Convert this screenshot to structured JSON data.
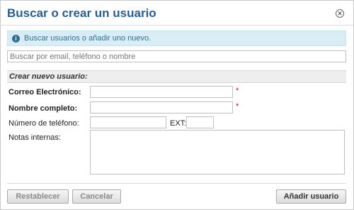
{
  "dialog": {
    "title": "Buscar o crear un usuario",
    "close_icon": "close-circle-icon",
    "info": {
      "icon": "info-icon",
      "text": "Buscar usuarios o añadir uno nuevo."
    },
    "search": {
      "placeholder": "Buscar por email, teléfono o nombre",
      "value": ""
    },
    "form": {
      "section_title": "Crear nuevo usuario:",
      "email_label": "Correo Electrónico:",
      "name_label": "Nombre completo:",
      "phone_label": "Número de teléfono:",
      "ext_label": "EXT:",
      "notes_label": "Notas internas:",
      "required_marker": "*"
    },
    "buttons": {
      "reset": "Restablecer",
      "cancel": "Cancelar",
      "add": "Añadir usuario"
    }
  }
}
